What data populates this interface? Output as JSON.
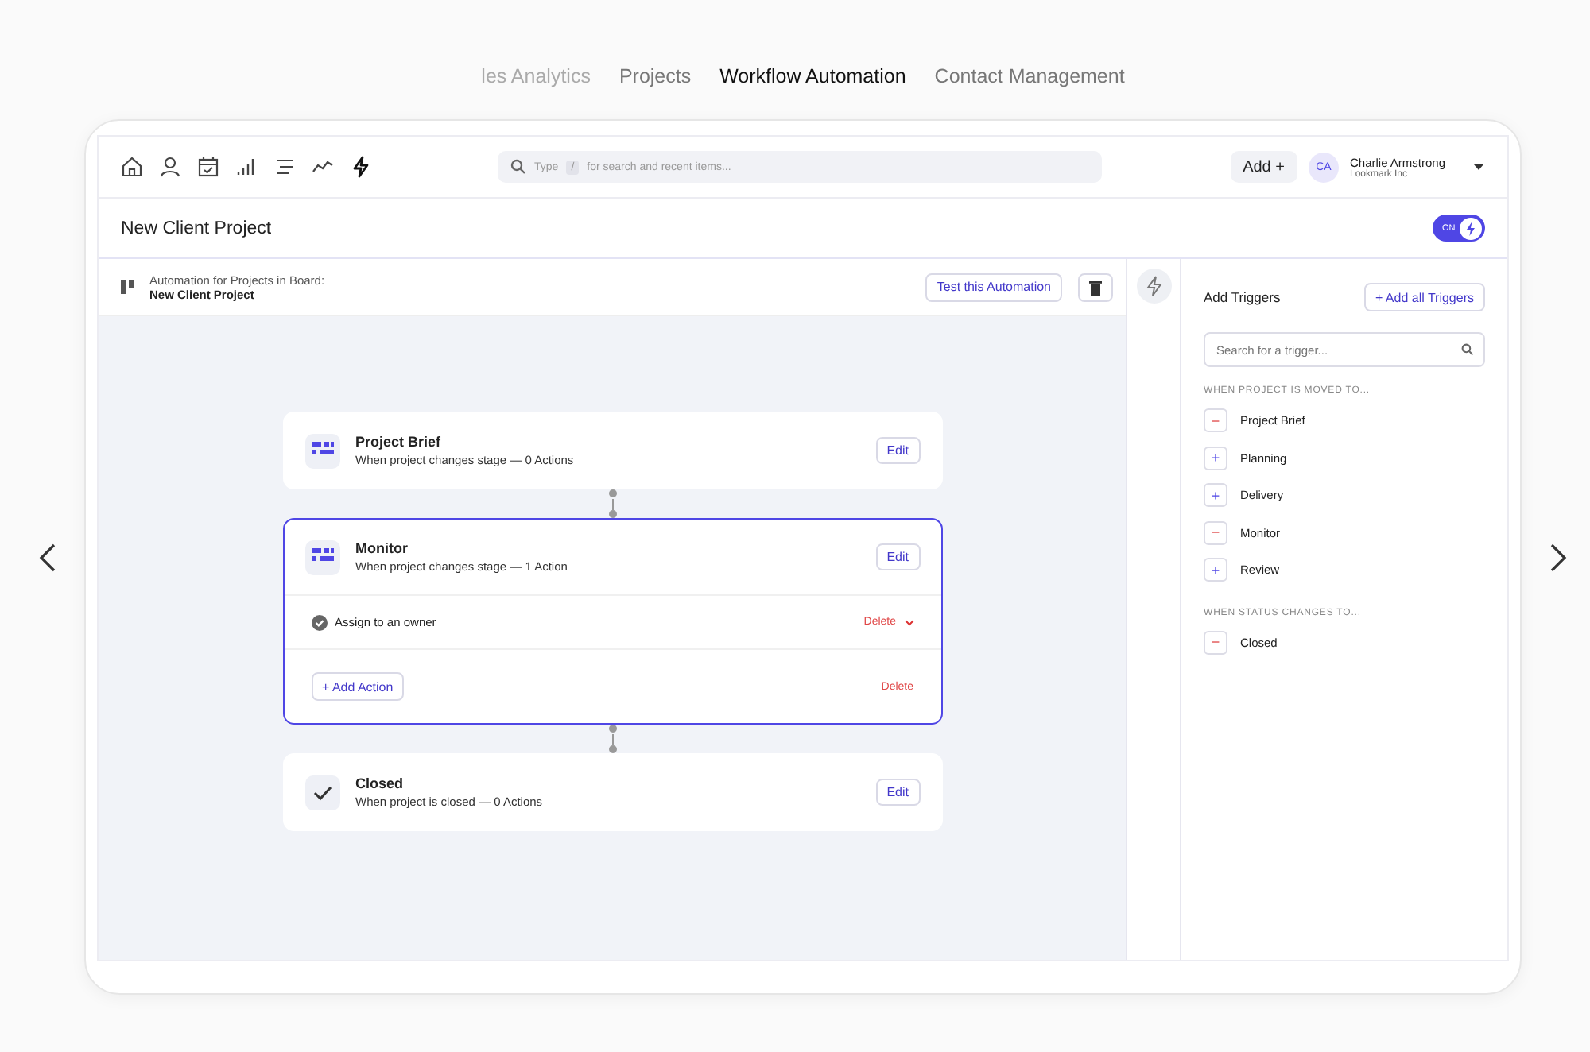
{
  "showcase_tabs": [
    {
      "label": "les Analytics",
      "selected": false,
      "cut": true
    },
    {
      "label": "Projects",
      "selected": false,
      "cut": false
    },
    {
      "label": "Workflow Automation",
      "selected": true,
      "cut": false
    },
    {
      "label": "Contact Management",
      "selected": false,
      "cut": false
    }
  ],
  "search": {
    "placeholder_before": "Type",
    "key": "/",
    "placeholder": "for search and recent items..."
  },
  "add_button": "Add +",
  "user": {
    "initials": "CA",
    "name": "Charlie Armstrong",
    "company": "Lookmark Inc"
  },
  "page_title": "New Client Project",
  "automation_toggle": {
    "label": "ON",
    "on": true
  },
  "board": {
    "caption": "Automation for Projects in Board:",
    "name": "New Client Project"
  },
  "test_button": "Test this Automation",
  "stages": [
    {
      "kind": "board",
      "title": "Project Brief",
      "subtitle": "When project changes stage — 0 Actions",
      "edit": "Edit",
      "selected": false
    },
    {
      "kind": "board",
      "title": "Monitor",
      "subtitle": "When project changes stage — 1 Action",
      "edit": "Edit",
      "selected": true,
      "actions": [
        {
          "label": "Assign to an owner",
          "delete": "Delete"
        }
      ],
      "add_action": "+ Add Action",
      "delete": "Delete"
    },
    {
      "kind": "check",
      "title": "Closed",
      "subtitle": "When project is closed — 0 Actions",
      "edit": "Edit",
      "selected": false
    }
  ],
  "triggers": {
    "title": "Add Triggers",
    "add_all": "+ Add all Triggers",
    "search_placeholder": "Search for a trigger...",
    "groups": [
      {
        "heading": "WHEN PROJECT IS MOVED TO...",
        "items": [
          {
            "label": "Project Brief",
            "added": true,
            "sign": "−"
          },
          {
            "label": "Planning",
            "added": false,
            "sign": "+"
          },
          {
            "label": "Delivery",
            "added": false,
            "sign": "+"
          },
          {
            "label": "Monitor",
            "added": true,
            "sign": "−"
          },
          {
            "label": "Review",
            "added": false,
            "sign": "+"
          }
        ]
      },
      {
        "heading": "WHEN STATUS CHANGES TO...",
        "items": [
          {
            "label": "Closed",
            "added": true,
            "sign": "−"
          }
        ]
      }
    ]
  }
}
